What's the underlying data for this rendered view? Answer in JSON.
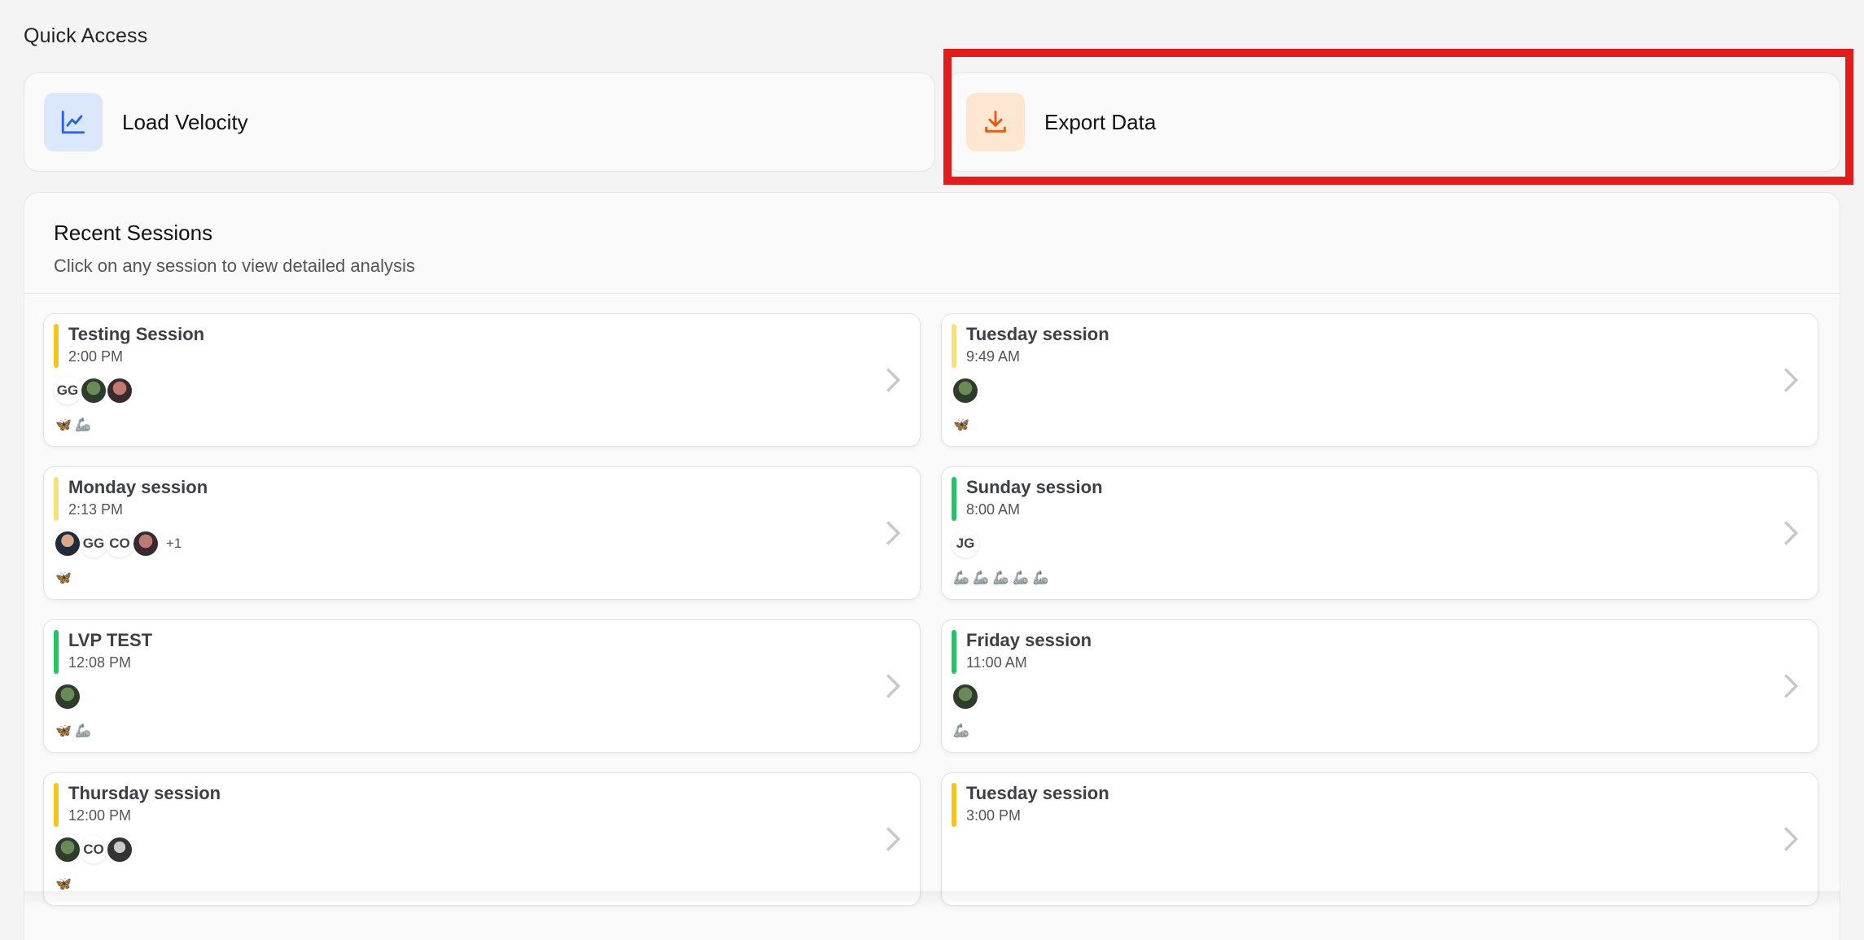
{
  "quick_access": {
    "title": "Quick Access",
    "cards": [
      {
        "label": "Load Velocity",
        "icon": "line-chart-icon",
        "color": "#2563eb",
        "bg": "#dbe7fb"
      },
      {
        "label": "Export Data",
        "icon": "download-icon",
        "color": "#ea580c",
        "bg": "#fde7d2"
      }
    ]
  },
  "recent": {
    "title": "Recent Sessions",
    "subtitle": "Click on any session to view detailed analysis",
    "sessions": [
      {
        "title": "Testing Session",
        "time": "2:00 PM",
        "status_color": "#f5c518",
        "avatars": [
          "GG"
        ],
        "more": "",
        "icons": "🦋 🦾"
      },
      {
        "title": "Tuesday session",
        "time": "9:49 AM",
        "status_color": "#f6e07a",
        "avatars": [],
        "more": "",
        "icons": "🦋"
      },
      {
        "title": "Monday session",
        "time": "2:13 PM",
        "status_color": "#f6e07a",
        "avatars": [
          "GG",
          "CO"
        ],
        "more": "+1",
        "icons": "🦋"
      },
      {
        "title": "Sunday session",
        "time": "8:00 AM",
        "status_color": "#22c55e",
        "avatars": [
          "JG"
        ],
        "more": "",
        "icons": "🦾 🦾 🦾 🦾 🦾"
      },
      {
        "title": "LVP TEST",
        "time": "12:08 PM",
        "status_color": "#22c55e",
        "avatars": [],
        "more": "",
        "icons": "🦋 🦾"
      },
      {
        "title": "Friday session",
        "time": "11:00 AM",
        "status_color": "#22c55e",
        "avatars": [],
        "more": "",
        "icons": "🦾"
      },
      {
        "title": "Thursday session",
        "time": "12:00 PM",
        "status_color": "#f5c518",
        "avatars": [
          "CO"
        ],
        "more": "",
        "icons": "🦋"
      },
      {
        "title": "Tuesday session",
        "time": "3:00 PM",
        "status_color": "#f5c518",
        "avatars": [],
        "more": "",
        "icons": ""
      }
    ]
  }
}
